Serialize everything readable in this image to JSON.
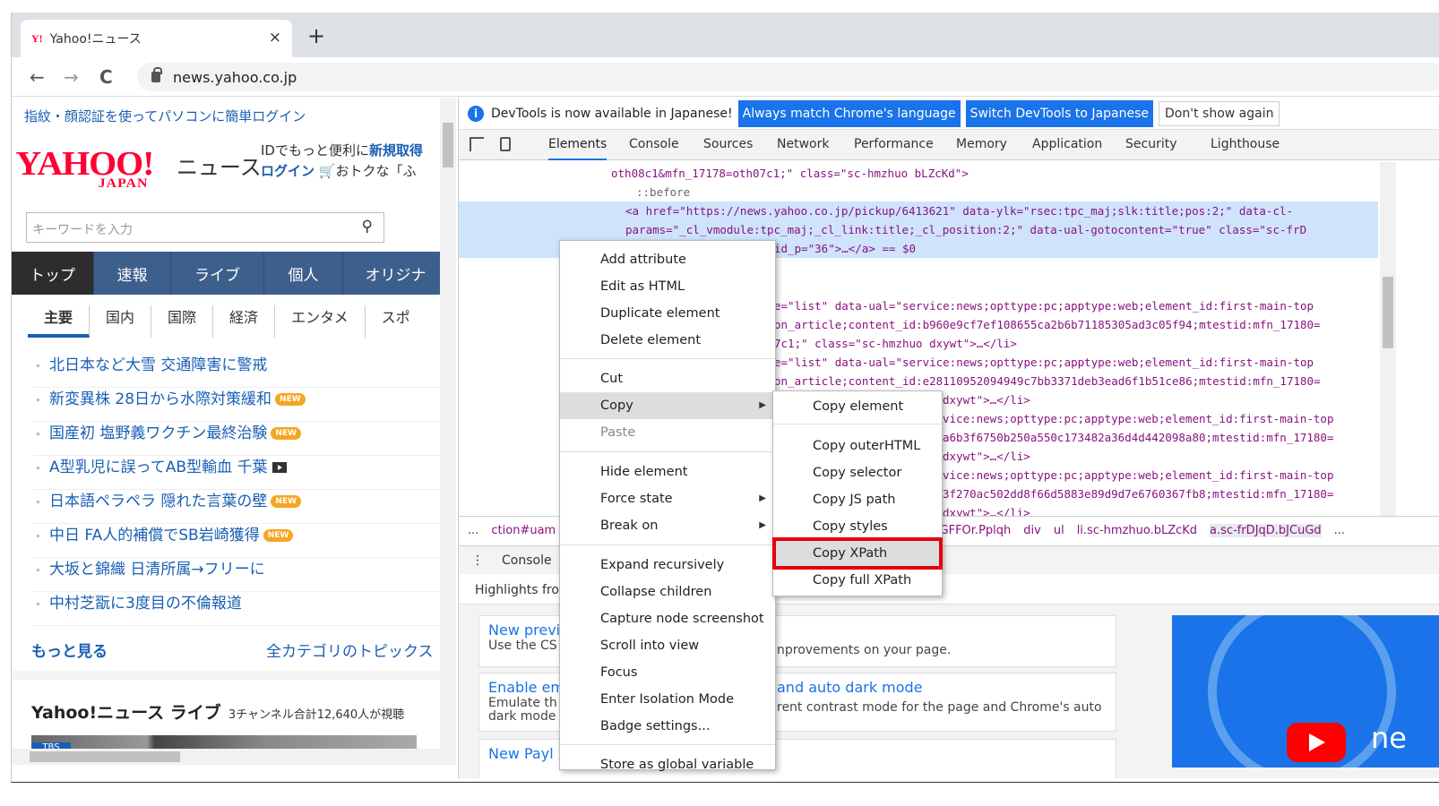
{
  "browser": {
    "tab_title": "Yahoo!ニュース",
    "tab_favicon": "Y!",
    "close": "×",
    "new_tab": "+",
    "back": "←",
    "forward": "→",
    "reload": "C",
    "url": "news.yahoo.co.jp"
  },
  "page": {
    "promo": "指紋・顔認証を使ってパソコンに簡単ログイン",
    "logo_main": "YAHOO!",
    "logo_sub": "JAPAN",
    "logo_news": "ニュース",
    "right_top_line1": "IDでもっと便利に",
    "right_top_link1": "新規取得",
    "right_top_line2_link": "ログイン",
    "right_top_line2": "おトクな「ふ",
    "search_placeholder": "キーワードを入力",
    "nav": [
      "トップ",
      "速報",
      "ライブ",
      "個人",
      "オリジナ"
    ],
    "cats": [
      "主要",
      "国内",
      "国際",
      "経済",
      "エンタメ",
      "スポ"
    ],
    "news": [
      {
        "title": "北日本など大雪 交通障害に警戒",
        "badge": ""
      },
      {
        "title": "新変異株 28日から水際対策緩和",
        "badge": "NEW"
      },
      {
        "title": "国産初 塩野義ワクチン最終治験",
        "badge": "NEW"
      },
      {
        "title": "A型乳児に誤ってAB型輸血 千葉",
        "badge": "video"
      },
      {
        "title": "日本語ペラペラ 隠れた言葉の壁",
        "badge": "NEW"
      },
      {
        "title": "中日 FA人的補償でSB岩崎獲得",
        "badge": "NEW"
      },
      {
        "title": "大坂と錦織 日清所属→フリーに",
        "badge": ""
      },
      {
        "title": "中村芝翫に3度目の不倫報道",
        "badge": ""
      }
    ],
    "more": "もっと見る",
    "all_cat": "全カテゴリのトピックス",
    "live_title": "Yahoo!ニュース ライブ",
    "live_sub": "3チャンネル合計12,640人が視聴",
    "thumb_label": "TBS"
  },
  "devtools": {
    "info": "DevTools is now available in Japanese!",
    "btn_match": "Always match Chrome's language",
    "btn_switch": "Switch DevTools to Japanese",
    "btn_dont": "Don't show again",
    "tabs": [
      "Elements",
      "Console",
      "Sources",
      "Network",
      "Performance",
      "Memory",
      "Application",
      "Security",
      "Lighthouse"
    ],
    "code_lines": [
      "oth08c1&mfn_17178=oth07c1;\" class=\"sc-hmzhuo bLZcKd\">",
      "::before",
      "<a href=\"https://news.yahoo.co.jp/pickup/6413621\" data-ylk=\"rsec:tpc_maj;slk:title;pos:2;\" data-cl-",
      "params=\"_cl_vmodule:tpc_maj;_cl_link:title;_cl_position:2;\" data-ual-gotocontent=\"true\" class=\"sc-frD",
      "id_p=\"36\">…</a> == $0",
      "e=\"list\" data-ual=\"service:news;opttype:pc;apptype:web;element_id:first-main-top",
      "on_article;content_id:b960e9cf7ef108655ca2b6b71185305ad3c05f94;mtestid:mfn_17180=",
      "7c1;\" class=\"sc-hmzhuo dxywt\">…</li>",
      "e=\"list\" data-ual=\"service:news;opttype:pc;apptype:web;element_id:first-main-top",
      "on_article;content_id:e28110952094949c7bb3371deb3ead6f1b51ce86;mtestid:mfn_17180=",
      "dxywt\">…</li>",
      "vice:news;opttype:pc;apptype:web;element_id:first-main-top",
      "a6b3f6750b250a550c173482a36d4d442098a80;mtestid:mfn_17180=",
      "dxywt\">…</li>",
      "vice:news;opttype:pc;apptype:web;element_id:first-main-top",
      "3f270ac502dd8f66d5883e89d9d7e6760367fb8;mtestid:mfn_17180=",
      "dxywt\">…</li>"
    ],
    "crumbs": [
      "...",
      "ction#uam",
      "-jGFFOr.Pplqh",
      "div",
      "ul",
      "li.sc-hmzhuo.bLZcKd",
      "a.sc-frDJqD.bJCuGd",
      "..."
    ],
    "drawer_tab": "Console",
    "drawer_text": "Highlights fro",
    "cards": [
      {
        "title": "New previ",
        "desc": "Use the CS",
        "desc2": "nprovements on your page."
      },
      {
        "title": "Enable em",
        "title2": "and auto dark mode",
        "desc": "Emulate th",
        "desc2": "rent contrast mode for the page and Chrome's auto",
        "desc3": "dark mode"
      },
      {
        "title": "New Payl"
      }
    ],
    "yt_text": "ne"
  },
  "context_menu": {
    "items": [
      "Add attribute",
      "Edit as HTML",
      "Duplicate element",
      "Delete element",
      "Cut",
      "Copy",
      "Paste",
      "Hide element",
      "Force state",
      "Break on",
      "Expand recursively",
      "Collapse children",
      "Capture node screenshot",
      "Scroll into view",
      "Focus",
      "Enter Isolation Mode",
      "Badge settings...",
      "Store as global variable"
    ]
  },
  "copy_submenu": {
    "items": [
      "Copy element",
      "Copy outerHTML",
      "Copy selector",
      "Copy JS path",
      "Copy styles",
      "Copy XPath",
      "Copy full XPath"
    ]
  },
  "colors": {
    "highlight": "#e8000b",
    "devtools_blue": "#1a73e8",
    "yahoo_red": "#ff0033"
  }
}
